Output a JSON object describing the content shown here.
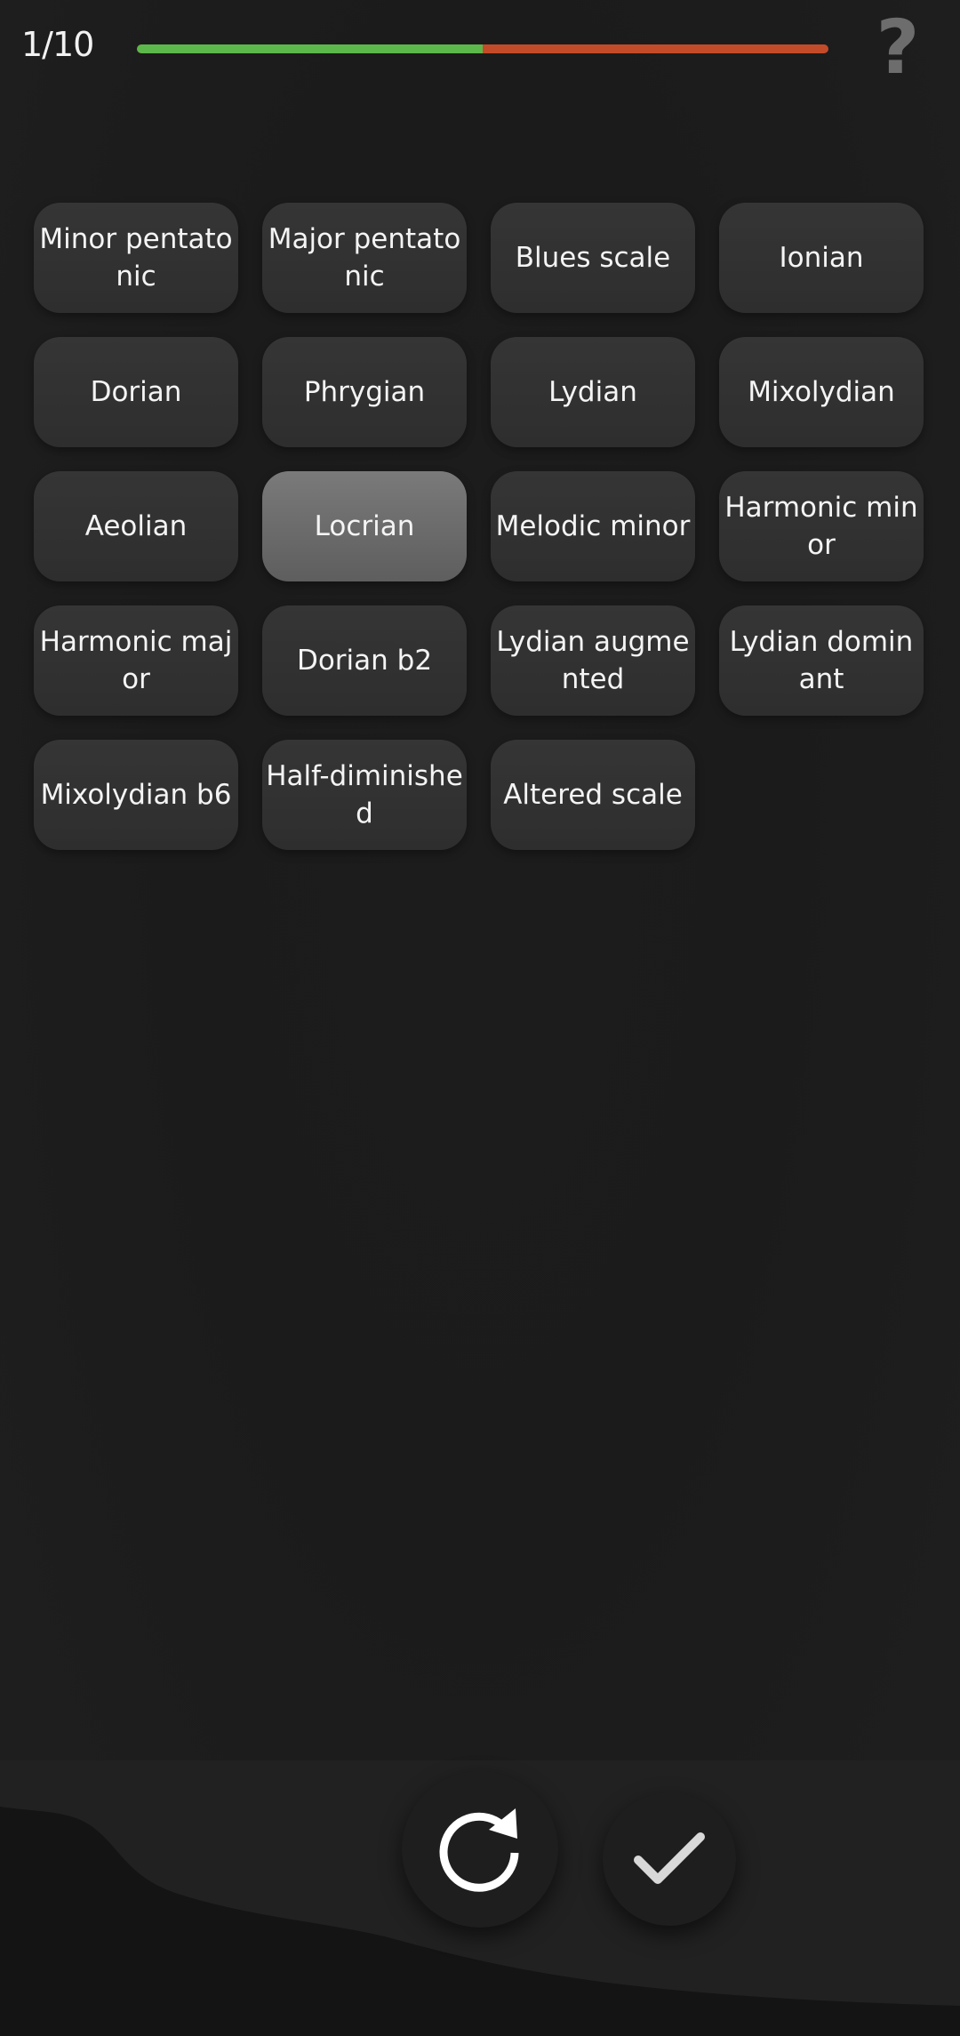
{
  "header": {
    "counter": "1/10",
    "progress": 0.5,
    "progress_colors": {
      "done": "#5cb84a",
      "remaining": "#c44b2a"
    },
    "help_label": "?"
  },
  "scales": [
    {
      "label": "Minor pentatonic",
      "selected": false
    },
    {
      "label": "Major pentatonic",
      "selected": false
    },
    {
      "label": "Blues scale",
      "selected": false
    },
    {
      "label": "Ionian",
      "selected": false
    },
    {
      "label": "Dorian",
      "selected": false
    },
    {
      "label": "Phrygian",
      "selected": false
    },
    {
      "label": "Lydian",
      "selected": false
    },
    {
      "label": "Mixolydian",
      "selected": false
    },
    {
      "label": "Aeolian",
      "selected": false
    },
    {
      "label": "Locrian",
      "selected": true
    },
    {
      "label": "Melodic minor",
      "selected": false
    },
    {
      "label": "Harmonic minor",
      "selected": false
    },
    {
      "label": "Harmonic major",
      "selected": false
    },
    {
      "label": "Dorian b2",
      "selected": false
    },
    {
      "label": "Lydian augmented",
      "selected": false
    },
    {
      "label": "Lydian dominant",
      "selected": false
    },
    {
      "label": "Mixolydian b6",
      "selected": false
    },
    {
      "label": "Half-diminished",
      "selected": false
    },
    {
      "label": "Altered scale",
      "selected": false
    }
  ],
  "actions": {
    "replay_icon": "replay-icon",
    "confirm_icon": "checkmark-icon"
  }
}
